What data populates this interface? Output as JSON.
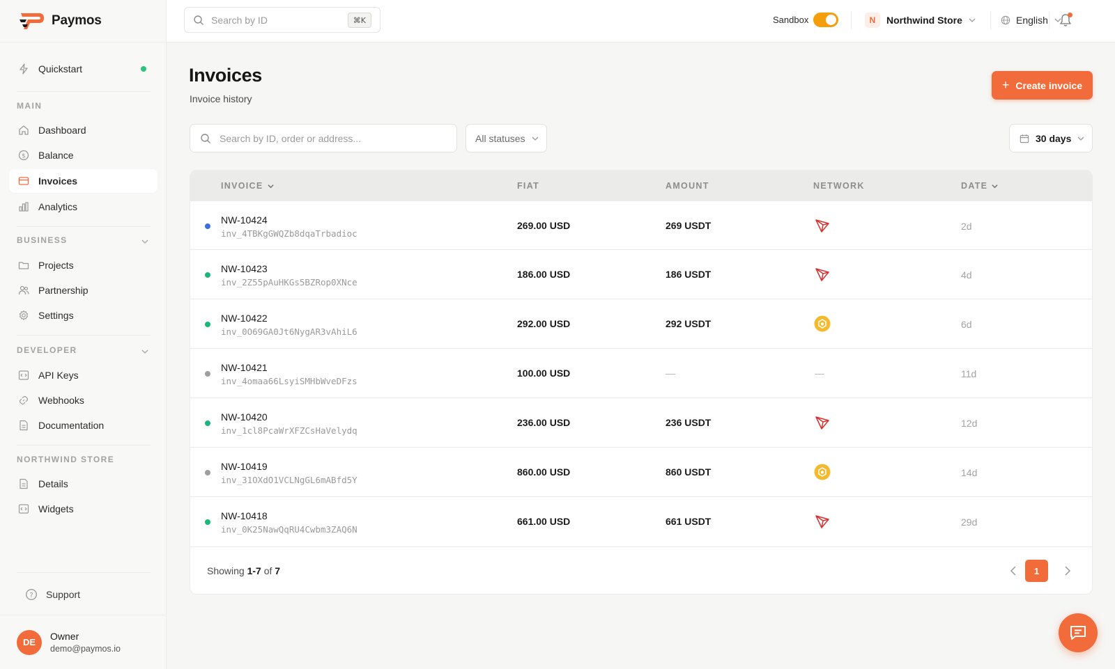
{
  "brand": {
    "name": "Paymos"
  },
  "topbar": {
    "search_placeholder": "Search by ID",
    "shortcut": "⌘K",
    "sandbox_label": "Sandbox",
    "sandbox_on": true,
    "store_initial": "N",
    "store_name": "Northwind Store",
    "language": "English"
  },
  "sidebar": {
    "quickstart": "Quickstart",
    "sections": {
      "main": "MAIN",
      "business": "BUSINESS",
      "developer": "DEVELOPER",
      "store": "NORTHWIND STORE"
    },
    "items": {
      "dashboard": "Dashboard",
      "balance": "Balance",
      "invoices": "Invoices",
      "analytics": "Analytics",
      "projects": "Projects",
      "partnership": "Partnership",
      "settings": "Settings",
      "api_keys": "API Keys",
      "webhooks": "Webhooks",
      "documentation": "Documentation",
      "details": "Details",
      "widgets": "Widgets"
    },
    "support": "Support",
    "user": {
      "initials": "DE",
      "name": "Owner",
      "email": "demo@paymos.io"
    }
  },
  "page": {
    "title": "Invoices",
    "subtitle": "Invoice history",
    "create_label": "Create invoice",
    "filter_placeholder": "Search by ID, order or address...",
    "status_filter": "All statuses",
    "range_filter": "30 days"
  },
  "table": {
    "headers": {
      "invoice": "INVOICE",
      "fiat": "FIAT",
      "amount": "AMOUNT",
      "network": "NETWORK",
      "date": "DATE"
    },
    "rows": [
      {
        "id": "NW-10424",
        "ref": "inv_4TBKgGWQZb8dqaTrbadioc",
        "fiat": "269.00 USD",
        "amount": "269 USDT",
        "network": "tron",
        "date": "2d",
        "status_color": "#3b6fe0"
      },
      {
        "id": "NW-10423",
        "ref": "inv_2Z55pAuHKGs5BZRop0XNce",
        "fiat": "186.00 USD",
        "amount": "186 USDT",
        "network": "tron",
        "date": "4d",
        "status_color": "#1fb57a"
      },
      {
        "id": "NW-10422",
        "ref": "inv_0O69GA0Jt6NygAR3vAhiL6",
        "fiat": "292.00 USD",
        "amount": "292 USDT",
        "network": "bnb",
        "date": "6d",
        "status_color": "#1fb57a"
      },
      {
        "id": "NW-10421",
        "ref": "inv_4omaa66LsyiSMHbWveDFzs",
        "fiat": "100.00 USD",
        "amount": "—",
        "network": "—",
        "date": "11d",
        "status_color": "#9e9e9e"
      },
      {
        "id": "NW-10420",
        "ref": "inv_1cl8PcaWrXFZCsHaVelydq",
        "fiat": "236.00 USD",
        "amount": "236 USDT",
        "network": "tron",
        "date": "12d",
        "status_color": "#1fb57a"
      },
      {
        "id": "NW-10419",
        "ref": "inv_31OXdO1VCLNgGL6mABfd5Y",
        "fiat": "860.00 USD",
        "amount": "860 USDT",
        "network": "bnb",
        "date": "14d",
        "status_color": "#9e9e9e"
      },
      {
        "id": "NW-10418",
        "ref": "inv_0K25NawQqRU4Cwbm3ZAQ6N",
        "fiat": "661.00 USD",
        "amount": "661 USDT",
        "network": "tron",
        "date": "29d",
        "status_color": "#1fb57a"
      }
    ]
  },
  "pagination": {
    "showing_prefix": "Showing",
    "range": "1-7",
    "of_word": "of",
    "total": "7",
    "current_page": "1"
  },
  "colors": {
    "accent": "#f26b3a",
    "toggle": "#f59e0b"
  }
}
